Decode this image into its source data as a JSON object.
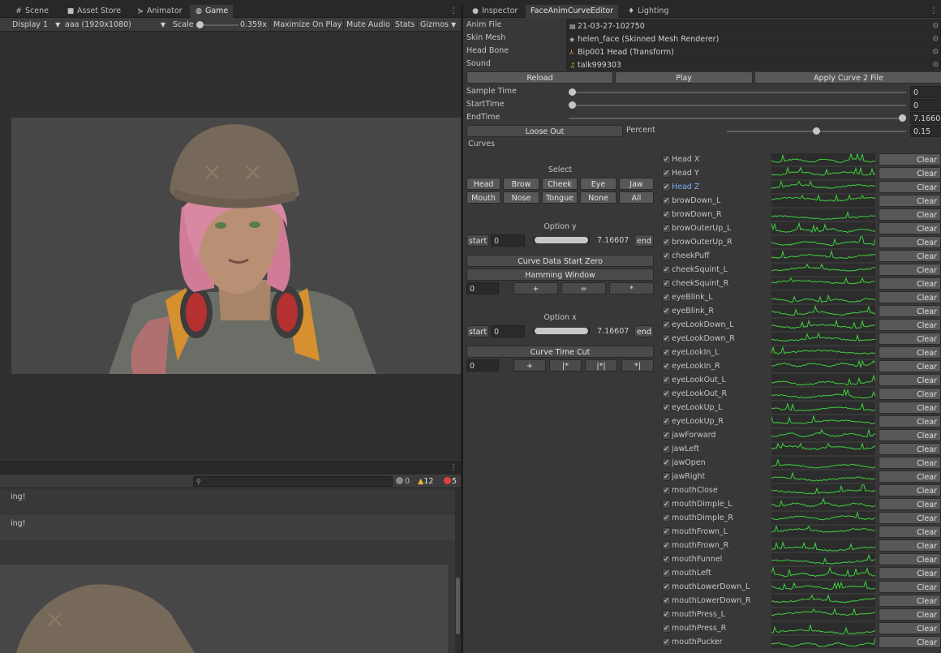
{
  "game_tabs": [
    {
      "label": "Scene",
      "icon": "grid-icon"
    },
    {
      "label": "Asset Store",
      "icon": "store-icon"
    },
    {
      "label": "Animator",
      "icon": "animator-icon"
    },
    {
      "label": "Game",
      "icon": "gamepad-icon"
    }
  ],
  "game_toolbar": {
    "display": "Display 1",
    "resolution": "aaa (1920x1080)",
    "scale_label": "Scale",
    "scale_value": "0.359x",
    "maximize": "Maximize On Play",
    "mute": "Mute Audio",
    "stats": "Stats",
    "gizmos": "Gizmos"
  },
  "console": {
    "counts": {
      "info": "0",
      "warn": "12",
      "error": "5"
    },
    "rows": [
      "ing!",
      "ing!"
    ]
  },
  "right_tabs": [
    {
      "label": "Inspector",
      "icon": "info-icon"
    },
    {
      "label": "FaceAnimCurveEditor",
      "icon": ""
    },
    {
      "label": "Lighting",
      "icon": "lightbulb-icon"
    }
  ],
  "fields": {
    "anim_file": {
      "label": "Anim File",
      "value": "21-03-27-102750"
    },
    "skin_mesh": {
      "label": "Skin Mesh",
      "value": "helen_face (Skinned Mesh Renderer)"
    },
    "head_bone": {
      "label": "Head Bone",
      "value": "Bip001 Head (Transform)"
    },
    "sound": {
      "label": "Sound",
      "value": "talk999303"
    }
  },
  "buttons": {
    "reload": "Reload",
    "play": "Play",
    "apply": "Apply Curve 2 File",
    "loose_out": "Loose Out"
  },
  "sliders": {
    "sample_time": {
      "label": "Sample Time",
      "value": "0",
      "fraction": 0
    },
    "start_time": {
      "label": "StartTime",
      "value": "0",
      "fraction": 0
    },
    "end_time": {
      "label": "EndTime",
      "value": "7.16607",
      "fraction": 1
    },
    "percent": {
      "label": "Percent",
      "value": "0.15",
      "fraction": 0.5
    }
  },
  "curves_label": "Curves",
  "select": {
    "title": "Select",
    "buttons": [
      "Head",
      "Brow",
      "Cheek",
      "Eye",
      "Jaw",
      "Mouth",
      "Nose",
      "Tongue",
      "None",
      "All"
    ]
  },
  "option_y": {
    "title": "Option y",
    "start_btn": "start",
    "start_value": "0",
    "end_value": "7.16607",
    "end_btn": "end"
  },
  "curve_data_start_zero": "Curve Data Start Zero",
  "hamming_window": "Hamming Window",
  "hamming_ops": {
    "value": "0",
    "ops": [
      "+",
      "=",
      "*"
    ]
  },
  "option_x": {
    "title": "Option x",
    "start_btn": "start",
    "start_value": "0",
    "end_value": "7.16607",
    "end_btn": "end"
  },
  "curve_time_cut": "Curve Time Cut",
  "time_cut_ops": {
    "value": "0",
    "ops": [
      "+",
      "|*",
      "|*|",
      "*|"
    ]
  },
  "clear_label": "Clear",
  "check_glyph": "✓",
  "curve_color": "#3fcf3f",
  "curves": [
    {
      "name": "Head X",
      "checked": true
    },
    {
      "name": "Head Y",
      "checked": true
    },
    {
      "name": "Head Z",
      "checked": true,
      "highlight": true
    },
    {
      "name": "browDown_L",
      "checked": true
    },
    {
      "name": "browDown_R",
      "checked": true
    },
    {
      "name": "browOuterUp_L",
      "checked": true
    },
    {
      "name": "browOuterUp_R",
      "checked": true
    },
    {
      "name": "cheekPuff",
      "checked": true
    },
    {
      "name": "cheekSquint_L",
      "checked": true
    },
    {
      "name": "cheekSquint_R",
      "checked": true
    },
    {
      "name": "eyeBlink_L",
      "checked": true
    },
    {
      "name": "eyeBlink_R",
      "checked": true
    },
    {
      "name": "eyeLookDown_L",
      "checked": true
    },
    {
      "name": "eyeLookDown_R",
      "checked": true
    },
    {
      "name": "eyeLookIn_L",
      "checked": true
    },
    {
      "name": "eyeLookIn_R",
      "checked": true
    },
    {
      "name": "eyeLookOut_L",
      "checked": true
    },
    {
      "name": "eyeLookOut_R",
      "checked": true
    },
    {
      "name": "eyeLookUp_L",
      "checked": true
    },
    {
      "name": "eyeLookUp_R",
      "checked": true
    },
    {
      "name": "jawForward",
      "checked": true
    },
    {
      "name": "jawLeft",
      "checked": true
    },
    {
      "name": "jawOpen",
      "checked": true
    },
    {
      "name": "jawRight",
      "checked": true
    },
    {
      "name": "mouthClose",
      "checked": true
    },
    {
      "name": "mouthDimple_L",
      "checked": true
    },
    {
      "name": "mouthDimple_R",
      "checked": true
    },
    {
      "name": "mouthFrown_L",
      "checked": true
    },
    {
      "name": "mouthFrown_R",
      "checked": true
    },
    {
      "name": "mouthFunnel",
      "checked": true
    },
    {
      "name": "mouthLeft",
      "checked": true
    },
    {
      "name": "mouthLowerDown_L",
      "checked": true
    },
    {
      "name": "mouthLowerDown_R",
      "checked": true
    },
    {
      "name": "mouthPress_L",
      "checked": true
    },
    {
      "name": "mouthPress_R",
      "checked": true
    },
    {
      "name": "mouthPucker",
      "checked": true
    }
  ]
}
